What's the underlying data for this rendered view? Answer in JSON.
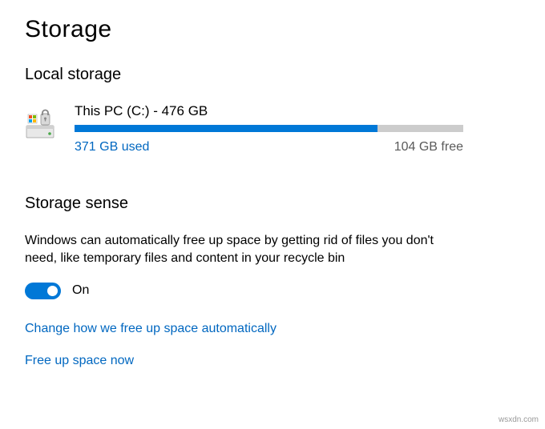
{
  "page": {
    "title": "Storage"
  },
  "local_storage": {
    "heading": "Local storage",
    "drive": {
      "name": "This PC (C:) - 476 GB",
      "used_label": "371 GB used",
      "free_label": "104 GB free",
      "fill_percent": "78%"
    }
  },
  "storage_sense": {
    "heading": "Storage sense",
    "description": "Windows can automatically free up space by getting rid of files you don't need, like temporary files and content in your recycle bin",
    "toggle_state": "On",
    "link_configure": "Change how we free up space automatically",
    "link_free_now": "Free up space now"
  },
  "watermark": "wsxdn.com"
}
